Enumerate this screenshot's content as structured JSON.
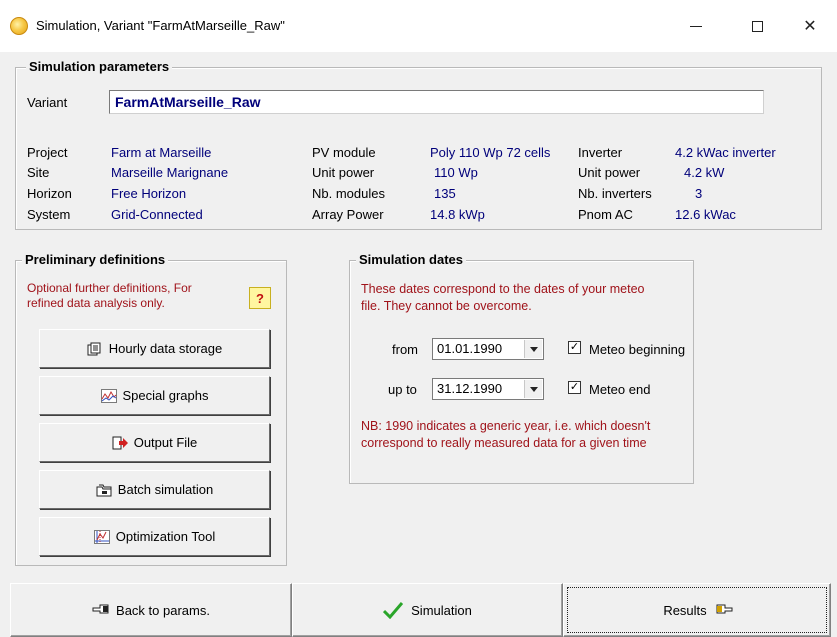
{
  "window": {
    "title": "Simulation, Variant  \"FarmAtMarseille_Raw\"",
    "minimize_glyph": "—",
    "maximize_glyph": "☐",
    "close_glyph": "✕"
  },
  "sim_params": {
    "group_title": "Simulation parameters",
    "variant_label": "Variant",
    "variant_value": "FarmAtMarseille_Raw",
    "col1": [
      {
        "label": "Project",
        "value": "Farm at Marseille"
      },
      {
        "label": "Site",
        "value": "Marseille Marignane"
      },
      {
        "label": "Horizon",
        "value": "Free Horizon"
      },
      {
        "label": "System",
        "value": "Grid-Connected"
      }
    ],
    "col2": [
      {
        "label": "PV module",
        "value": "Poly 110 Wp  72 cells"
      },
      {
        "label": "Unit power",
        "value": "110 Wp"
      },
      {
        "label": "Nb. modules",
        "value": "135"
      },
      {
        "label": "Array Power",
        "value": "14.8 kWp"
      }
    ],
    "col3": [
      {
        "label": "Inverter",
        "value": "4.2 kWac inverter"
      },
      {
        "label": "Unit power",
        "value": "4.2  kW"
      },
      {
        "label": "Nb. inverters",
        "value": "3"
      },
      {
        "label": "Pnom AC",
        "value": "12.6  kWac"
      }
    ]
  },
  "prelim": {
    "group_title": "Preliminary definitions",
    "note": [
      "Optional further definitions, For",
      "refined data analysis only."
    ],
    "help_glyph": "?",
    "buttons": [
      {
        "label": "Hourly data storage",
        "icon": "storage-icon"
      },
      {
        "label": "Special graphs",
        "icon": "graph-icon"
      },
      {
        "label": "Output File",
        "icon": "output-file-icon"
      },
      {
        "label": "Batch simulation",
        "icon": "batch-icon"
      },
      {
        "label": "Optimization Tool",
        "icon": "optimization-icon"
      }
    ]
  },
  "dates": {
    "group_title": "Simulation dates",
    "note": [
      "These dates correspond to the dates of  your meteo",
      "file. They cannot be overcome."
    ],
    "from_label": "from",
    "from_value": "01.01.1990",
    "from_check_label": "Meteo beginning",
    "from_checked": true,
    "to_label": "up to",
    "to_value": "31.12.1990",
    "to_check_label": "Meteo end",
    "to_checked": true,
    "nb_note": [
      "NB: 1990 indicates a generic year, i.e. which doesn't",
      "correspond to really measured data for a given time"
    ]
  },
  "bottom": {
    "back_label": "Back to params.",
    "simulation_label": "Simulation",
    "results_label": "Results"
  },
  "colors": {
    "value_text": "#00007a",
    "note_red": "#a0131a",
    "check_green": "#2aa52a"
  }
}
